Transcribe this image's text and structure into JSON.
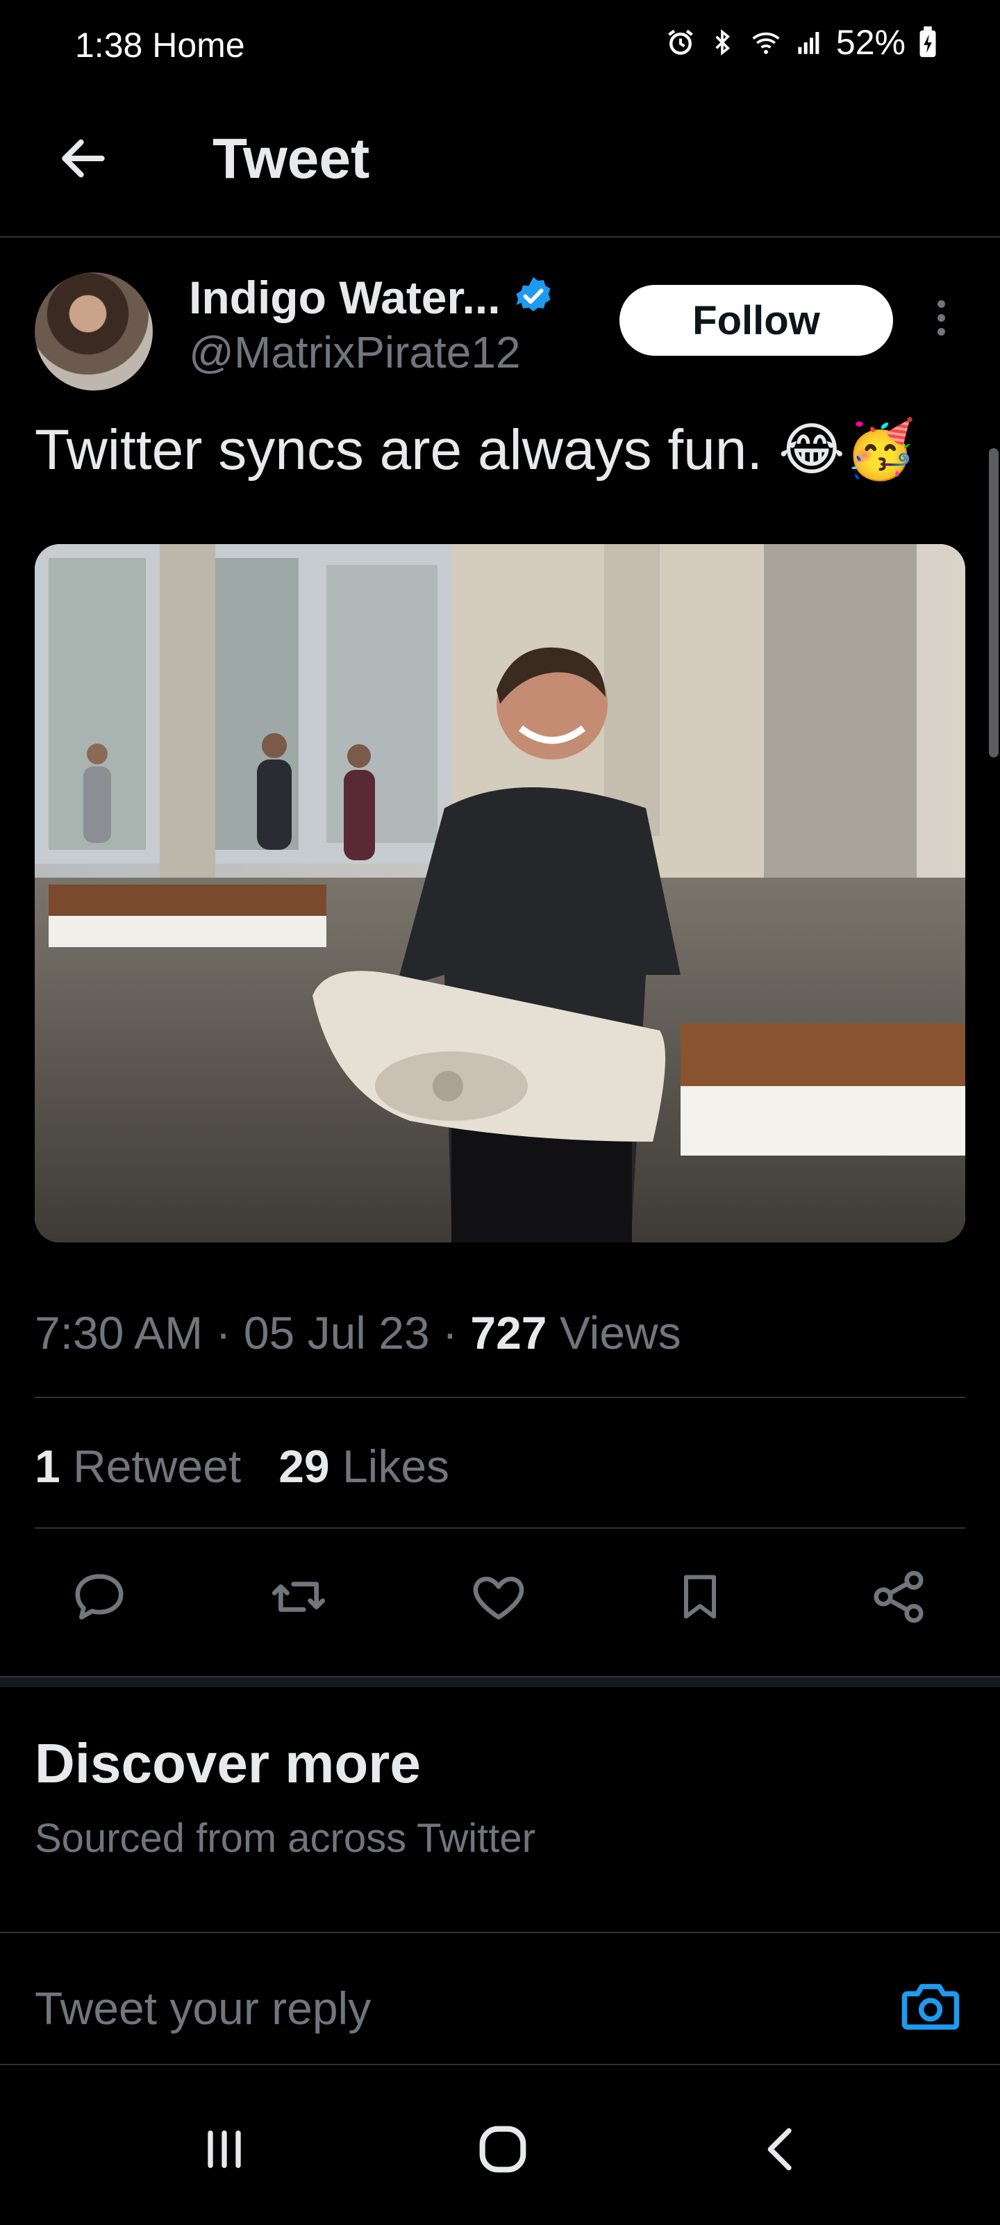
{
  "status_bar": {
    "time": "1:38 Home",
    "battery": "52%"
  },
  "header": {
    "title": "Tweet",
    "back_icon": "arrow-left-icon"
  },
  "tweet": {
    "author": {
      "name": "Indigo Water...",
      "handle": "@MatrixPirate12",
      "verified": true
    },
    "follow_label": "Follow",
    "text": "Twitter syncs are always fun. 😂🥳",
    "meta": {
      "time": "7:30 AM",
      "date": "05 Jul 23",
      "views_count": "727",
      "views_label": "Views",
      "separator": "·"
    },
    "stats": {
      "retweets_count": "1",
      "retweets_label": "Retweet",
      "likes_count": "29",
      "likes_label": "Likes"
    },
    "actions": [
      "reply-icon",
      "retweet-icon",
      "like-icon",
      "bookmark-icon",
      "share-icon"
    ]
  },
  "discover": {
    "title": "Discover more",
    "subtitle": "Sourced from across Twitter"
  },
  "reply": {
    "placeholder": "Tweet your reply"
  },
  "colors": {
    "background": "#000000",
    "text_primary": "#e7e9ea",
    "text_secondary": "#71767b",
    "accent": "#1d9bf0",
    "divider": "#2f3336"
  }
}
